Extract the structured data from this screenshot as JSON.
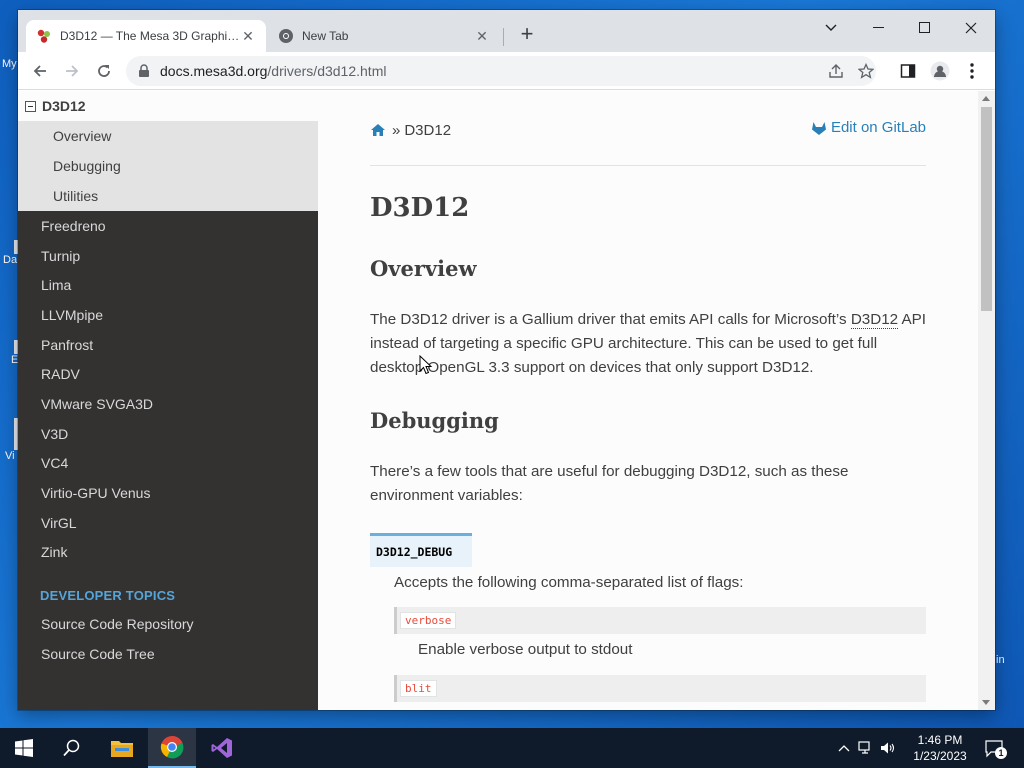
{
  "desktop": {
    "fragments": [
      "My",
      "Da",
      "E",
      "Vi",
      "in"
    ]
  },
  "browser": {
    "tabs": [
      {
        "title": "D3D12 — The Mesa 3D Graphics Library",
        "active": true
      },
      {
        "title": "New Tab",
        "active": false
      }
    ],
    "url": {
      "host": "docs.mesa3d.org",
      "path": "/drivers/d3d12.html"
    }
  },
  "sidebar": {
    "current": "D3D12",
    "current_subitems": [
      "Overview",
      "Debugging",
      "Utilities"
    ],
    "items": [
      "Freedreno",
      "Turnip",
      "Lima",
      "LLVMpipe",
      "Panfrost",
      "RADV",
      "VMware SVGA3D",
      "V3D",
      "VC4",
      "Virtio-GPU Venus",
      "VirGL",
      "Zink"
    ],
    "caption": "DEVELOPER TOPICS",
    "developer_items": [
      "Source Code Repository",
      "Source Code Tree"
    ]
  },
  "doc": {
    "breadcrumb_sep": "»",
    "breadcrumb_current": "D3D12",
    "edit_link": "Edit on GitLab",
    "title": "D3D12",
    "overview_heading": "Overview",
    "overview_p1": "The D3D12 driver is a Gallium driver that emits API calls for Microsoft’s",
    "overview_link": "D3D12",
    "overview_p2": "API instead of targeting a specific GPU architecture. This can be used to get full desktop OpenGL 3.3 support on devices that only support D3D12.",
    "debugging_heading": "Debugging",
    "debugging_p": "There’s a few tools that are useful for debugging D3D12, such as these environment variables:",
    "env_var": "D3D12_DEBUG",
    "env_desc": "Accepts the following comma-separated list of flags:",
    "flags": [
      {
        "name": "verbose",
        "desc": "Enable verbose output to stdout"
      },
      {
        "name": "blit",
        "desc": ""
      }
    ]
  },
  "taskbar": {
    "time": "1:46 PM",
    "date": "1/23/2023",
    "notification_count": "1"
  },
  "colors": {
    "sidebar_bg": "#343131",
    "link": "#2980b9",
    "caption": "#55a5d9",
    "code_red": "#e74c3c"
  }
}
